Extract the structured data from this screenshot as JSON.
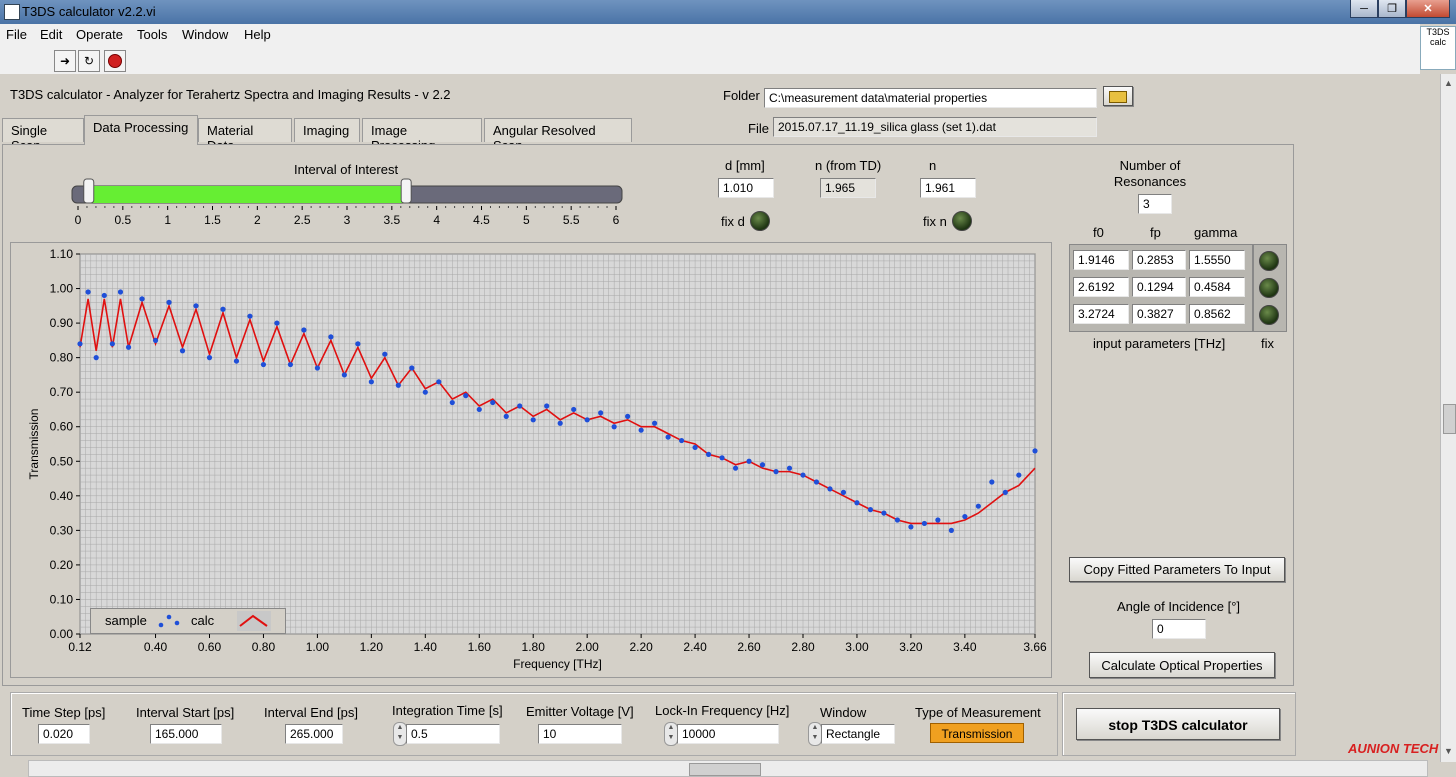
{
  "window": {
    "title": "T3DS calculator v2.2.vi",
    "minimize_icon": "minimize-icon",
    "maximize_icon": "restore-icon",
    "close_icon": "close-icon"
  },
  "menu": [
    "File",
    "Edit",
    "Operate",
    "Tools",
    "Window",
    "Help"
  ],
  "toolbar": {
    "run": "run-arrow-icon",
    "run_continuous": "run-continuously-icon",
    "abort": "abort-stop-icon"
  },
  "vi_icon_text": "T3DS calc",
  "app": {
    "heading": "T3DS calculator  -  Analyzer for Terahertz Spectra and Imaging Results  -  v 2.2",
    "folder_label": "Folder",
    "folder_value": "C:\\measurement data\\material properties",
    "file_label": "File",
    "file_value": "2015.07.17_11.19_silica glass (set 1).dat"
  },
  "tabs": [
    "Single Scan",
    "Data Processing",
    "Material Data",
    "Imaging",
    "Image Processing",
    "Angular Resolved Scan"
  ],
  "active_tab": "Data Processing",
  "interval": {
    "label": "Interval of Interest",
    "ticks": [
      "0",
      "0.5",
      "1",
      "1.5",
      "2",
      "2.5",
      "3",
      "3.5",
      "4",
      "4.5",
      "5",
      "5.5",
      "6"
    ],
    "min": 0,
    "max": 6,
    "low": 0.12,
    "high": 3.66,
    "fill_color": "#66ee33"
  },
  "params": {
    "d_label": "d [mm]",
    "d_value": "1.010",
    "ntd_label": "n (from TD)",
    "ntd_value": "1.965",
    "n_label": "n",
    "n_value": "1.961",
    "fix_d": "fix d",
    "fix_n": "fix n"
  },
  "resonances": {
    "label": "Number of Resonances",
    "count": "3",
    "headers": [
      "f0",
      "fp",
      "gamma"
    ],
    "rows": [
      [
        "1.9146",
        "0.2853",
        "1.5550"
      ],
      [
        "2.6192",
        "0.1294",
        "0.4584"
      ],
      [
        "3.2724",
        "0.3827",
        "0.8562"
      ]
    ],
    "footer": "input parameters [THz]",
    "fix_label": "fix"
  },
  "copy_button": "Copy Fitted Parameters To Input",
  "angle": {
    "label": "Angle of Incidence [°]",
    "value": "0"
  },
  "calc_button": "Calculate Optical Properties",
  "bottom": {
    "time_step_label": "Time Step [ps]",
    "time_step": "0.020",
    "int_start_label": "Interval Start [ps]",
    "int_start": "165.000",
    "int_end_label": "Interval End [ps]",
    "int_end": "265.000",
    "integration_label": "Integration Time [s]",
    "integration": "0.5",
    "emitter_label": "Emitter Voltage [V]",
    "emitter": "10",
    "lockin_label": "Lock-In Frequency [Hz]",
    "lockin": "10000",
    "window_label": "Window",
    "window": "Rectangle",
    "type_label": "Type of Measurement",
    "type": "Transmission"
  },
  "stop_button": "stop T3DS calculator",
  "watermark": "AUNION TECH",
  "colors": {
    "sample": "#1f4fd8",
    "calc": "#e01010",
    "type_bg": "#f0a020"
  },
  "chart_data": {
    "type": "scatter",
    "xlabel": "Frequency [THz]",
    "ylabel": "Transmission",
    "xlim": [
      0.12,
      3.66
    ],
    "ylim": [
      0.0,
      1.1
    ],
    "x_ticks": [
      "0.12",
      "0.40",
      "0.60",
      "0.80",
      "1.00",
      "1.20",
      "1.40",
      "1.60",
      "1.80",
      "2.00",
      "2.20",
      "2.40",
      "2.60",
      "2.80",
      "3.00",
      "3.20",
      "3.40",
      "3.66"
    ],
    "y_ticks": [
      "0.00",
      "0.10",
      "0.20",
      "0.30",
      "0.40",
      "0.50",
      "0.60",
      "0.70",
      "0.80",
      "0.90",
      "1.00",
      "1.10"
    ],
    "grid": true,
    "legend_position": "bottom-left",
    "series": [
      {
        "name": "sample",
        "style": "points",
        "x": [
          0.12,
          0.15,
          0.18,
          0.21,
          0.24,
          0.27,
          0.3,
          0.35,
          0.4,
          0.45,
          0.5,
          0.55,
          0.6,
          0.65,
          0.7,
          0.75,
          0.8,
          0.85,
          0.9,
          0.95,
          1.0,
          1.05,
          1.1,
          1.15,
          1.2,
          1.25,
          1.3,
          1.35,
          1.4,
          1.45,
          1.5,
          1.55,
          1.6,
          1.65,
          1.7,
          1.75,
          1.8,
          1.85,
          1.9,
          1.95,
          2.0,
          2.05,
          2.1,
          2.15,
          2.2,
          2.25,
          2.3,
          2.35,
          2.4,
          2.45,
          2.5,
          2.55,
          2.6,
          2.65,
          2.7,
          2.75,
          2.8,
          2.85,
          2.9,
          2.95,
          3.0,
          3.05,
          3.1,
          3.15,
          3.2,
          3.25,
          3.3,
          3.35,
          3.4,
          3.45,
          3.5,
          3.55,
          3.6,
          3.66
        ],
        "y": [
          0.84,
          0.99,
          0.8,
          0.98,
          0.84,
          0.99,
          0.83,
          0.97,
          0.85,
          0.96,
          0.82,
          0.95,
          0.8,
          0.94,
          0.79,
          0.92,
          0.78,
          0.9,
          0.78,
          0.88,
          0.77,
          0.86,
          0.75,
          0.84,
          0.73,
          0.81,
          0.72,
          0.77,
          0.7,
          0.73,
          0.67,
          0.69,
          0.65,
          0.67,
          0.63,
          0.66,
          0.62,
          0.66,
          0.61,
          0.65,
          0.62,
          0.64,
          0.6,
          0.63,
          0.59,
          0.61,
          0.57,
          0.56,
          0.54,
          0.52,
          0.51,
          0.48,
          0.5,
          0.49,
          0.47,
          0.48,
          0.46,
          0.44,
          0.42,
          0.41,
          0.38,
          0.36,
          0.35,
          0.33,
          0.31,
          0.32,
          0.33,
          0.3,
          0.34,
          0.37,
          0.44,
          0.41,
          0.46,
          0.53
        ]
      },
      {
        "name": "calc",
        "style": "line",
        "x": [
          0.12,
          0.15,
          0.18,
          0.21,
          0.24,
          0.27,
          0.3,
          0.35,
          0.4,
          0.45,
          0.5,
          0.55,
          0.6,
          0.65,
          0.7,
          0.75,
          0.8,
          0.85,
          0.9,
          0.95,
          1.0,
          1.05,
          1.1,
          1.15,
          1.2,
          1.25,
          1.3,
          1.35,
          1.4,
          1.45,
          1.5,
          1.55,
          1.6,
          1.65,
          1.7,
          1.75,
          1.8,
          1.85,
          1.9,
          1.95,
          2.0,
          2.05,
          2.1,
          2.15,
          2.2,
          2.25,
          2.3,
          2.35,
          2.4,
          2.45,
          2.5,
          2.55,
          2.6,
          2.65,
          2.7,
          2.75,
          2.8,
          2.85,
          2.9,
          2.95,
          3.0,
          3.05,
          3.1,
          3.15,
          3.2,
          3.25,
          3.3,
          3.35,
          3.4,
          3.45,
          3.5,
          3.55,
          3.6,
          3.66
        ],
        "y": [
          0.83,
          0.97,
          0.82,
          0.97,
          0.83,
          0.97,
          0.83,
          0.96,
          0.84,
          0.95,
          0.83,
          0.94,
          0.81,
          0.93,
          0.8,
          0.91,
          0.79,
          0.89,
          0.78,
          0.87,
          0.77,
          0.85,
          0.75,
          0.83,
          0.74,
          0.8,
          0.72,
          0.77,
          0.71,
          0.73,
          0.68,
          0.7,
          0.66,
          0.68,
          0.64,
          0.66,
          0.63,
          0.65,
          0.62,
          0.64,
          0.62,
          0.63,
          0.61,
          0.62,
          0.6,
          0.6,
          0.58,
          0.56,
          0.55,
          0.52,
          0.51,
          0.49,
          0.5,
          0.48,
          0.47,
          0.47,
          0.46,
          0.44,
          0.42,
          0.4,
          0.38,
          0.36,
          0.35,
          0.33,
          0.32,
          0.32,
          0.32,
          0.32,
          0.33,
          0.35,
          0.38,
          0.41,
          0.43,
          0.48
        ]
      }
    ]
  }
}
